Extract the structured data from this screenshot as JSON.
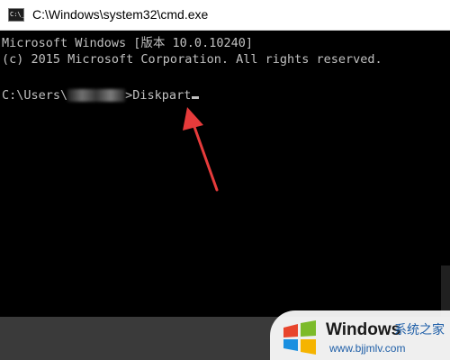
{
  "window": {
    "title": "C:\\Windows\\system32\\cmd.exe",
    "icon": "cmd-icon",
    "icon_text": "C:\\_"
  },
  "console": {
    "line_1": "Microsoft Windows [版本 10.0.10240]",
    "line_2": "(c) 2015 Microsoft Corporation. All rights reserved.",
    "prompt_prefix": "C:\\Users\\",
    "prompt_suffix": ">",
    "command": "Diskpart",
    "text_color": "#c0c0c0",
    "background": "#000000"
  },
  "annotation": {
    "icon": "arrow-annotation-icon",
    "color": "#e63b3b"
  },
  "watermark": {
    "brand": "Windows",
    "brand_cn": "系统之家",
    "url": "www.bjjmlv.com"
  }
}
